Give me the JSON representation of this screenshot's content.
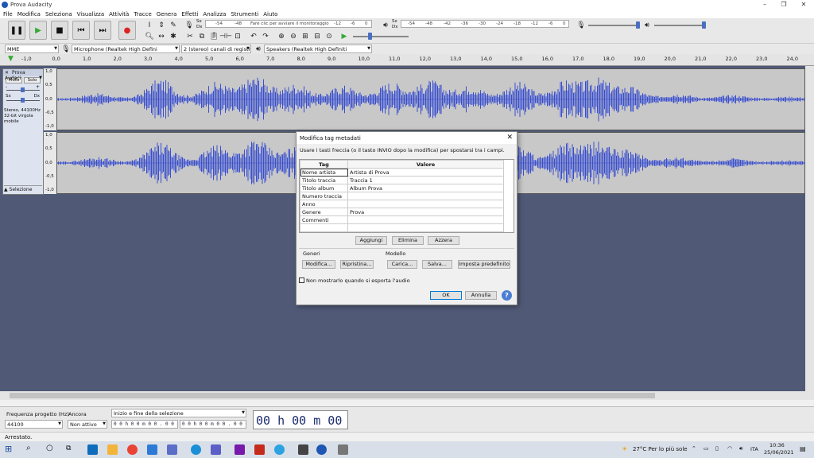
{
  "window": {
    "title": "Prova Audacity"
  },
  "menu": [
    "File",
    "Modifica",
    "Seleziona",
    "Visualizza",
    "Attività",
    "Tracce",
    "Genera",
    "Effetti",
    "Analizza",
    "Strumenti",
    "Aiuto"
  ],
  "meter": {
    "monitor_text": "Fare clic per avviare il monitoraggio",
    "rec_ticks": [
      "-54",
      "-48",
      "-12",
      "-6",
      "0"
    ],
    "play_ticks": [
      "-54",
      "-48",
      "-42",
      "-36",
      "-30",
      "-24",
      "-18",
      "-12",
      "-6",
      "0"
    ],
    "sx": "Sx",
    "dx": "Dx"
  },
  "devices": {
    "host": "MME",
    "mic": "Microphone (Realtek High Defini",
    "channels": "2 (stereo) canali di registrazi",
    "speakers": "Speakers (Realtek High Definiti"
  },
  "ruler": [
    "-1,0",
    "0,0",
    "1,0",
    "2,0",
    "3,0",
    "4,0",
    "5,0",
    "6,0",
    "7,0",
    "8,0",
    "9,0",
    "10,0",
    "11,0",
    "12,0",
    "13,0",
    "14,0",
    "15,0",
    "16,0",
    "17,0",
    "18,0",
    "19,0",
    "20,0",
    "21,0",
    "22,0",
    "23,0",
    "24,0"
  ],
  "track": {
    "name": "Prova Audaci",
    "mute": "Muto",
    "solo": "Solo",
    "minus": "-",
    "plus": "+",
    "sx": "Sx",
    "dx": "Dx",
    "info1": "Stereo, 44100Hz",
    "info2": "32-bit virgola mobile",
    "select": "Selezione",
    "scale": [
      "1,0",
      "0,5",
      "0,0",
      "-0,5",
      "-1,0"
    ]
  },
  "dialog": {
    "title": "Modifica tag metadati",
    "instructions": "Usare i tasti freccia (o il tasto INVIO dopo la modifica) per spostarsi tra i campi.",
    "col_tag": "Tag",
    "col_value": "Valore",
    "rows": [
      {
        "tag": "Nome artista",
        "value": "Artista di Prova"
      },
      {
        "tag": "Titolo traccia",
        "value": "Traccia 1"
      },
      {
        "tag": "Titolo album",
        "value": "Album Prova"
      },
      {
        "tag": "Numero traccia",
        "value": ""
      },
      {
        "tag": "Anno",
        "value": ""
      },
      {
        "tag": "Genere",
        "value": "Prova"
      },
      {
        "tag": "Commenti",
        "value": ""
      },
      {
        "tag": "",
        "value": ""
      }
    ],
    "add": "Aggiungi",
    "remove": "Elimina",
    "clear": "Azzera",
    "genres_label": "Generi",
    "template_label": "Modello",
    "edit": "Modifica...",
    "reset": "Ripristina...",
    "load": "Carica...",
    "save": "Salva...",
    "set_default": "Imposta predefinito",
    "dont_show": "Non mostrarlo quando si esporta l'audio",
    "ok": "OK",
    "cancel": "Annulla",
    "help": "?"
  },
  "selection": {
    "rate_label": "Frequenza progetto (Hz)",
    "rate_value": "44100",
    "snap_label": "Ancora",
    "snap_value": "Non attivo",
    "sel_label": "Inizio e fine della selezione",
    "start": "0 0 h 0 0 m 0 0 . 0 0 0 s",
    "end": "0 0 h 0 0 m 0 0 . 0 0 0 s",
    "time": "00 h 00 m 00 s"
  },
  "status": "Arrestato.",
  "taskbar": {
    "weather": "27°C  Per lo più sole",
    "lang": "ITA",
    "time": "10:36",
    "date": "25/06/2021"
  }
}
